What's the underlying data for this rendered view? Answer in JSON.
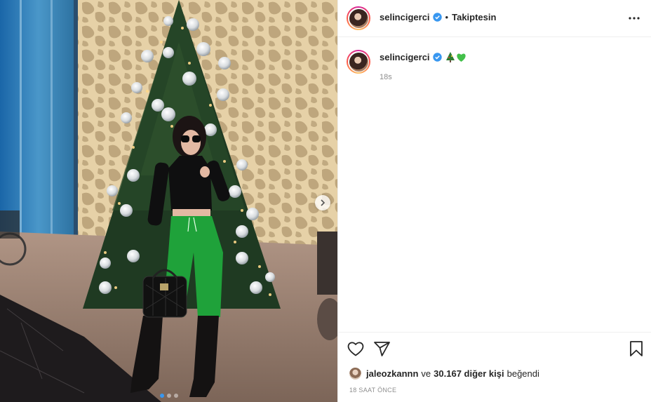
{
  "post": {
    "username": "selincigerci",
    "follow_separator": "•",
    "follow_status": "Takiptesin",
    "caption_username": "selincigerci",
    "caption_emojis": [
      "christmas-tree-emoji",
      "green-heart-emoji"
    ],
    "caption_time": "18s",
    "likes": {
      "first_liker": "jaleozkannn",
      "connector": "ve",
      "others_count": "30.167 diğer kişi",
      "suffix": "beğendi"
    },
    "timestamp": "18 SAAT ÖNCE",
    "carousel": {
      "slides": 3,
      "active_index": 0
    }
  },
  "colors": {
    "verified_blue": "#3897f0",
    "pants_green": "#1fa23a",
    "text": "#262626",
    "muted": "#8e8e8e"
  },
  "icons": [
    "verified-badge-icon",
    "more-options-icon",
    "heart-icon",
    "share-icon",
    "bookmark-icon",
    "chevron-right-icon"
  ]
}
